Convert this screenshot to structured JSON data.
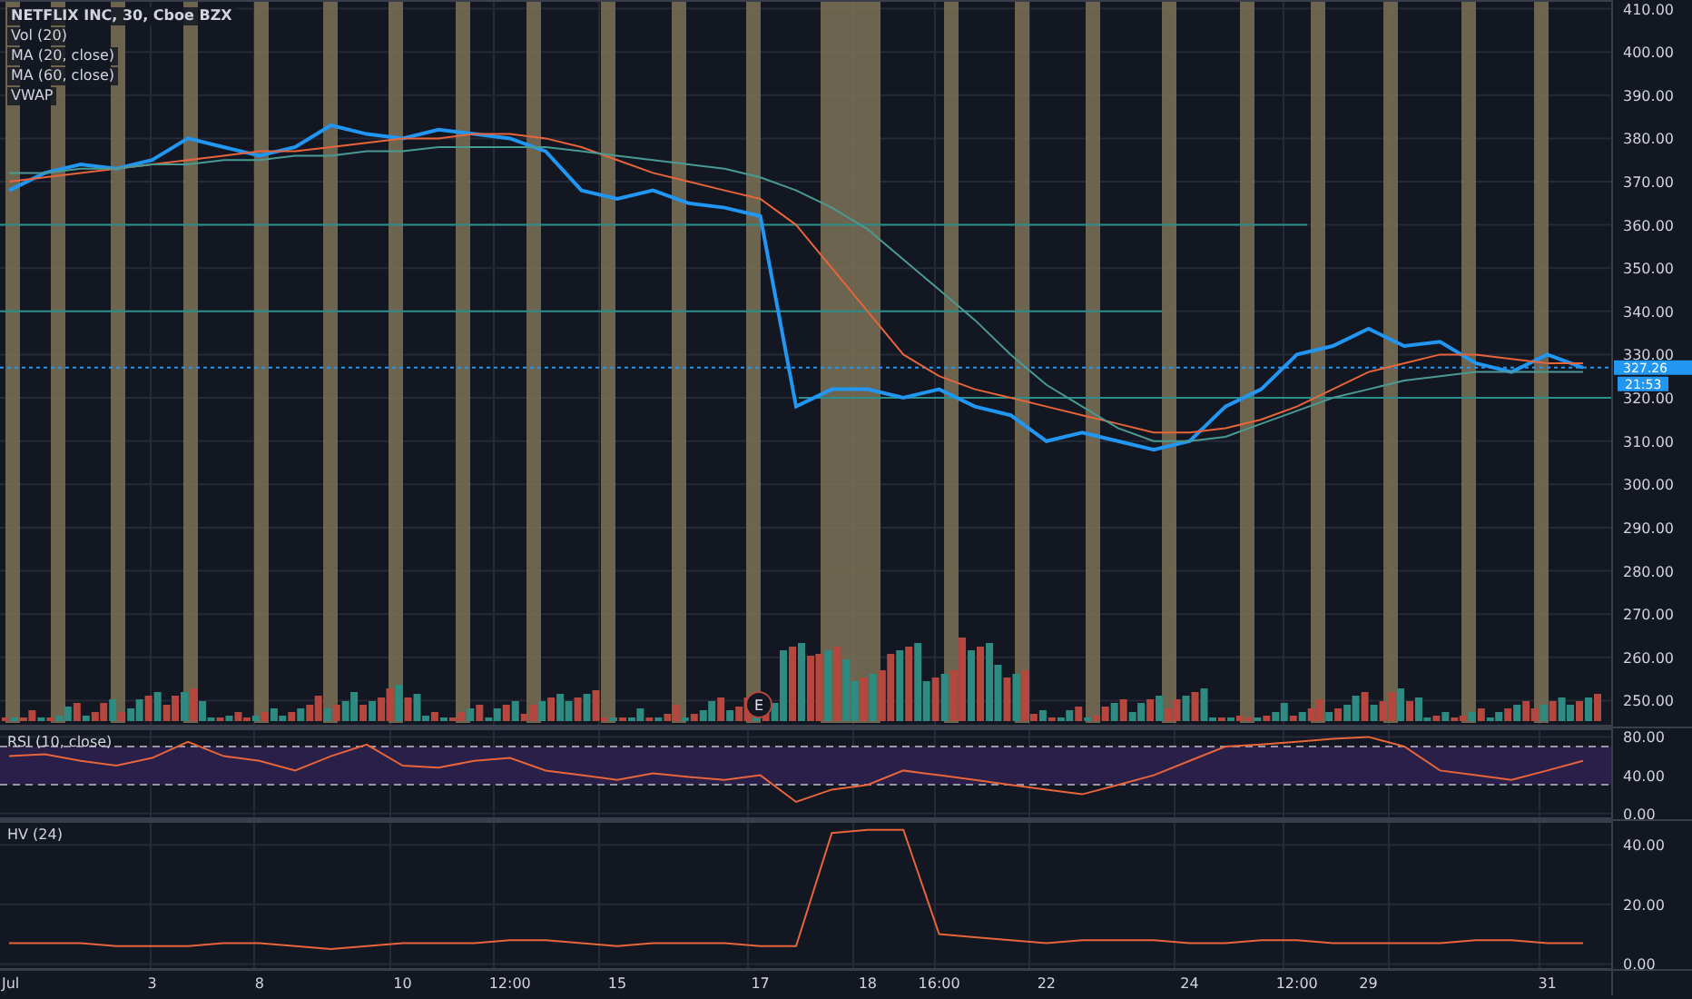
{
  "legend": {
    "title": "NETFLIX INC, 30, Cboe BZX",
    "indicators": [
      "Vol (20)",
      "MA (20, close)",
      "MA (60, close)",
      "VWAP"
    ]
  },
  "price_pane": {
    "price_tag": "327.26",
    "countdown": "21:53",
    "earnings_marker": "E",
    "chart_data": {
      "type": "line",
      "grid": true,
      "categories": [
        null,
        null,
        null,
        null,
        null,
        null,
        null,
        null,
        null,
        null,
        null,
        null,
        null,
        null,
        null,
        null,
        null,
        null,
        null,
        null,
        null,
        null,
        null,
        null,
        null,
        null,
        null,
        null,
        null,
        null,
        null,
        null,
        null,
        null,
        null,
        null,
        null,
        null,
        null,
        null,
        null,
        null,
        null,
        null,
        null
      ],
      "ylim": [
        244,
        412
      ],
      "yticks": [
        {
          "value": 250,
          "label": "250.00"
        },
        {
          "value": 260,
          "label": "260.00"
        },
        {
          "value": 270,
          "label": "270.00"
        },
        {
          "value": 280,
          "label": "280.00"
        },
        {
          "value": 290,
          "label": "290.00"
        },
        {
          "value": 300,
          "label": "300.00"
        },
        {
          "value": 310,
          "label": "310.00"
        },
        {
          "value": 320,
          "label": "320.00"
        },
        {
          "value": 330,
          "label": "330.00"
        },
        {
          "value": 340,
          "label": "340.00"
        },
        {
          "value": 350,
          "label": "350.00"
        },
        {
          "value": 360,
          "label": "360.00"
        },
        {
          "value": 370,
          "label": "370.00"
        },
        {
          "value": 380,
          "label": "380.00"
        },
        {
          "value": 390,
          "label": "390.00"
        },
        {
          "value": 400,
          "label": "400.00"
        },
        {
          "value": 410,
          "label": "410.00"
        }
      ],
      "series": [
        {
          "color": "#2196f3",
          "values": [
            368,
            372,
            374,
            373,
            375,
            380,
            378,
            376,
            378,
            383,
            381,
            380,
            382,
            381,
            380,
            377,
            368,
            366,
            368,
            365,
            364,
            362,
            318,
            322,
            322,
            320,
            322,
            318,
            316,
            310,
            312,
            310,
            308,
            310,
            318,
            322,
            330,
            332,
            336,
            332,
            333,
            328,
            326,
            330,
            327
          ]
        },
        {
          "color": "#e8643a",
          "values": [
            370,
            371,
            372,
            373,
            374,
            375,
            376,
            377,
            377,
            378,
            379,
            380,
            380,
            381,
            381,
            380,
            378,
            375,
            372,
            370,
            368,
            366,
            360,
            350,
            340,
            330,
            325,
            322,
            320,
            318,
            316,
            314,
            312,
            312,
            313,
            315,
            318,
            322,
            326,
            328,
            330,
            330,
            329,
            328,
            328
          ]
        },
        {
          "color": "#4a9a94",
          "values": [
            372,
            372,
            373,
            373,
            374,
            374,
            375,
            375,
            376,
            376,
            377,
            377,
            378,
            378,
            378,
            378,
            377,
            376,
            375,
            374,
            373,
            371,
            368,
            364,
            359,
            352,
            345,
            338,
            330,
            323,
            318,
            313,
            310,
            310,
            311,
            314,
            317,
            320,
            322,
            324,
            325,
            326,
            326,
            326,
            326
          ]
        }
      ]
    }
  },
  "rsi_pane": {
    "chart_data": {
      "type": "line",
      "grid": true,
      "categories": [
        null,
        null,
        null,
        null,
        null,
        null,
        null,
        null,
        null,
        null,
        null,
        null,
        null,
        null,
        null,
        null,
        null,
        null,
        null,
        null,
        null,
        null,
        null,
        null,
        null,
        null,
        null,
        null,
        null,
        null,
        null,
        null,
        null,
        null,
        null,
        null,
        null,
        null,
        null,
        null,
        null,
        null,
        null,
        null,
        null
      ],
      "ylim": [
        -6,
        89
      ],
      "yticks": [
        {
          "value": 0,
          "label": "0.00"
        },
        {
          "value": 40,
          "label": "40.00"
        },
        {
          "value": 80,
          "label": "80.00"
        }
      ],
      "series": [
        {
          "name": "RSI (10, close)",
          "color": "#e8643a",
          "values": [
            60,
            62,
            55,
            50,
            58,
            75,
            60,
            55,
            45,
            60,
            72,
            50,
            48,
            55,
            58,
            45,
            40,
            35,
            42,
            38,
            35,
            40,
            12,
            25,
            30,
            45,
            40,
            35,
            30,
            25,
            20,
            30,
            40,
            55,
            70,
            72,
            75,
            78,
            80,
            70,
            45,
            40,
            35,
            45,
            55
          ]
        }
      ]
    }
  },
  "hv_pane": {
    "chart_data": {
      "type": "line",
      "grid": true,
      "ylim": [
        -2,
        48
      ],
      "yticks": [
        {
          "value": 0,
          "label": "0.00"
        },
        {
          "value": 20,
          "label": "20.00"
        },
        {
          "value": 40,
          "label": "40.00"
        }
      ],
      "categories": [
        "Jul",
        null,
        null,
        null,
        "3",
        null,
        null,
        "8",
        null,
        null,
        null,
        "10",
        null,
        null,
        "12:00",
        null,
        null,
        "15",
        null,
        null,
        null,
        "17",
        null,
        null,
        "18",
        null,
        "16:00",
        null,
        null,
        "22",
        null,
        null,
        null,
        "24",
        null,
        null,
        "12:00",
        null,
        "29",
        null,
        null,
        null,
        null,
        "31",
        null
      ],
      "series": [
        {
          "name": "HV (24)",
          "color": "#e8643a",
          "values": [
            7,
            7,
            7,
            6,
            6,
            6,
            7,
            7,
            6,
            5,
            6,
            7,
            7,
            7,
            8,
            8,
            7,
            6,
            7,
            7,
            7,
            6,
            6,
            44,
            45,
            45,
            10,
            9,
            8,
            7,
            8,
            8,
            8,
            7,
            7,
            8,
            8,
            7,
            7,
            7,
            7,
            8,
            8,
            7,
            7
          ]
        }
      ]
    }
  }
}
